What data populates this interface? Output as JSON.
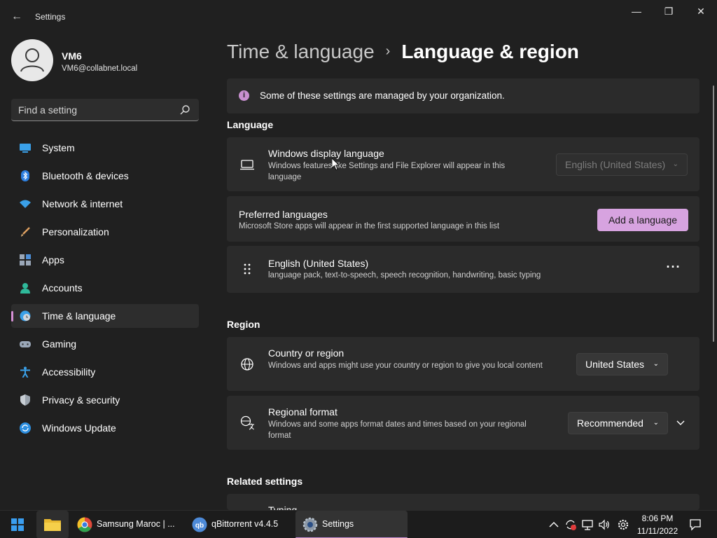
{
  "window": {
    "title": "Settings",
    "back": "←",
    "minimize": "—",
    "maximize": "❐",
    "close": "✕"
  },
  "profile": {
    "name": "VM6",
    "email": "VM6@collabnet.local"
  },
  "search": {
    "placeholder": "Find a setting"
  },
  "sidebar": {
    "items": [
      {
        "label": "System",
        "icon": "monitor-icon"
      },
      {
        "label": "Bluetooth & devices",
        "icon": "bluetooth-icon"
      },
      {
        "label": "Network & internet",
        "icon": "wifi-icon"
      },
      {
        "label": "Personalization",
        "icon": "brush-icon"
      },
      {
        "label": "Apps",
        "icon": "apps-icon"
      },
      {
        "label": "Accounts",
        "icon": "person-icon"
      },
      {
        "label": "Time & language",
        "icon": "clock-globe-icon",
        "active": true
      },
      {
        "label": "Gaming",
        "icon": "gamepad-icon"
      },
      {
        "label": "Accessibility",
        "icon": "accessibility-icon"
      },
      {
        "label": "Privacy & security",
        "icon": "shield-icon"
      },
      {
        "label": "Windows Update",
        "icon": "update-icon"
      }
    ]
  },
  "breadcrumb": {
    "parent": "Time & language",
    "separator": "›",
    "current": "Language & region"
  },
  "notice": {
    "icon": "i",
    "text": "Some of these settings are managed by your organization."
  },
  "language": {
    "title": "Language",
    "display_language": {
      "title": "Windows display language",
      "desc": "Windows features like Settings and File Explorer will appear in this language",
      "value": "English (United States)",
      "disabled": true
    },
    "preferred": {
      "title": "Preferred languages",
      "desc": "Microsoft Store apps will appear in the first supported language in this list",
      "button": "Add a language"
    },
    "entry": {
      "title": "English (United States)",
      "desc": "language pack, text-to-speech, speech recognition, handwriting, basic typing",
      "more": "···"
    }
  },
  "region": {
    "title": "Region",
    "country": {
      "title": "Country or region",
      "desc": "Windows and apps might use your country or region to give you local content",
      "value": "United States"
    },
    "format": {
      "title": "Regional format",
      "desc": "Windows and some apps format dates and times based on your regional format",
      "value": "Recommended"
    }
  },
  "related": {
    "title": "Related settings",
    "partial_item": "Typing"
  },
  "taskbar": {
    "apps": [
      {
        "label": "Samsung Maroc | ...",
        "icon": "chrome-icon"
      },
      {
        "label": "qBittorrent v4.4.5",
        "icon": "qbittorrent-icon"
      },
      {
        "label": "Settings",
        "icon": "settings-gear-icon",
        "active": true
      }
    ],
    "time": "8:06 PM",
    "date": "11/11/2022"
  },
  "colors": {
    "accent": "#d7a3e0",
    "background": "#202020",
    "card": "#2b2b2b"
  }
}
